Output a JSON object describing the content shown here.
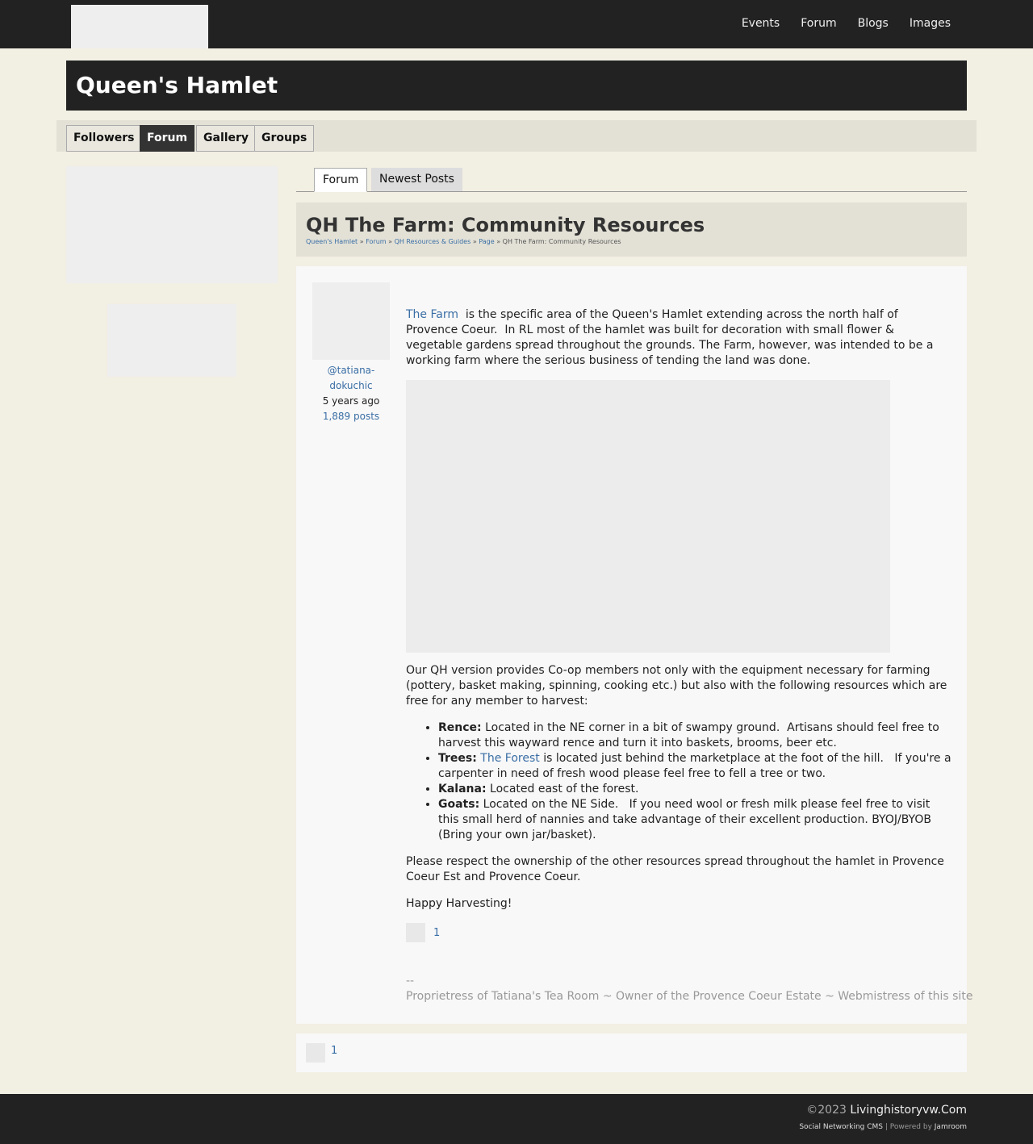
{
  "topnav": {
    "items": [
      "Events",
      "Forum",
      "Blogs",
      "Images"
    ]
  },
  "profile": {
    "name": "Queen's Hamlet"
  },
  "profile_menu": {
    "items": [
      "Followers",
      "Forum",
      "Gallery",
      "Groups"
    ],
    "active": "Forum"
  },
  "tabs": {
    "forum": "Forum",
    "newest": "Newest Posts"
  },
  "topic": {
    "title": "QH The Farm: Community Resources",
    "breadcrumb": {
      "c1": "Queen's Hamlet",
      "c2": "Forum",
      "c3": "QH Resources & Guides",
      "c4": "Page",
      "c5": "QH The Farm: Community Resources",
      "sep": "»"
    }
  },
  "post": {
    "user": "@tatiana-dokuchic",
    "time": "5 years ago",
    "posts": "1,889 posts",
    "intro_link": "The Farm",
    "intro_text": "  is the specific area of the Queen's Hamlet extending across the north half of Provence Coeur.  In RL most of the hamlet was built for decoration with small flower & vegetable gardens spread throughout the grounds. The Farm, however, was intended to be a working farm where the serious business of tending the land was done.",
    "coop_text": "Our QH version provides Co-op members not only with the equipment necessary for farming (pottery, basket making, spinning, cooking etc.) but also with the following resources which are free for any member to harvest:",
    "resources": [
      {
        "label": "Rence:",
        "text": " Located in the NE corner in a bit of swampy ground.  Artisans should feel free to harvest this wayward rence and turn it into baskets, brooms, beer etc."
      },
      {
        "label": "Trees:",
        "link": "The Forest",
        "text": " is located just behind the marketplace at the foot of the hill.   If you're a carpenter in need of fresh wood please feel free to fell a tree or two."
      },
      {
        "label": "Kalana:",
        "text": " Located east of the forest."
      },
      {
        "label": "Goats:",
        "text": " Located on the NE Side.   If you need wool or fresh milk please feel free to visit this small herd of nannies and take advantage of their excellent production. BYOJ/BYOB (Bring your own jar/basket)."
      }
    ],
    "respect_text": "Please respect the ownership of the other resources spread throughout the hamlet in Provence Coeur Est and Provence Coeur.",
    "closing": "Happy Harvesting!",
    "likes": "1",
    "sig_dash": "--",
    "signature": "Proprietress of Tatiana's Tea Room ~ Owner of the Provence Coeur Estate ~ Webmistress of this site"
  },
  "bottom_likes": "1",
  "footer": {
    "copyright": "©2023 ",
    "site": "Livinghistoryvw.Com",
    "cms": "Social Networking CMS",
    "powered": " | Powered by ",
    "jamroom": "Jamroom"
  }
}
